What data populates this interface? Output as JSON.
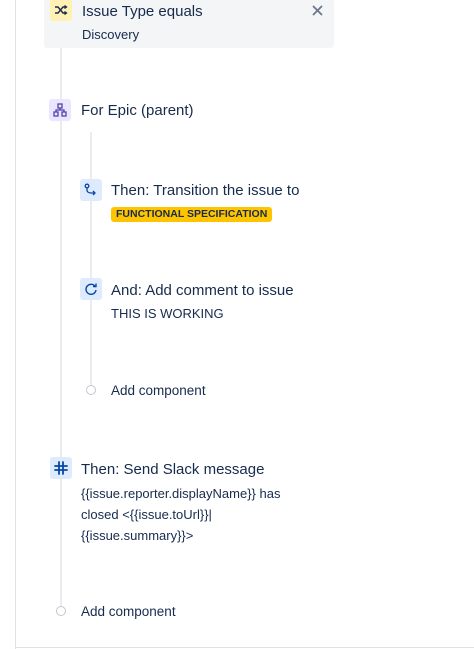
{
  "condition": {
    "title": "Issue Type equals",
    "value": "Discovery",
    "icon": "condition-shuffle-icon",
    "close_icon": "close-icon"
  },
  "branch": {
    "title": "For Epic (parent)",
    "icon": "branch-icon",
    "actions": [
      {
        "title": "Then: Transition the issue to",
        "status": "FUNCTIONAL SPECIFICATION",
        "icon": "transition-icon"
      },
      {
        "title": "And: Add comment to issue",
        "detail": "THIS IS WORKING",
        "icon": "comment-refresh-icon"
      }
    ],
    "add_component": "Add component"
  },
  "slack": {
    "title": "Then: Send Slack message",
    "lines": [
      "{{issue.reporter.displayName}} has",
      "closed <{{issue.toUrl}}|",
      "{{issue.summary}}>"
    ],
    "icon": "slack-icon"
  },
  "footer": {
    "add_component": "Add component"
  },
  "colors": {
    "lozenge": "#ffc400",
    "condition_icon_bg": "#fff0b3",
    "branch_icon_bg": "#eae6ff",
    "action_icon_bg": "#deebff",
    "rail": "#ebecf0"
  }
}
